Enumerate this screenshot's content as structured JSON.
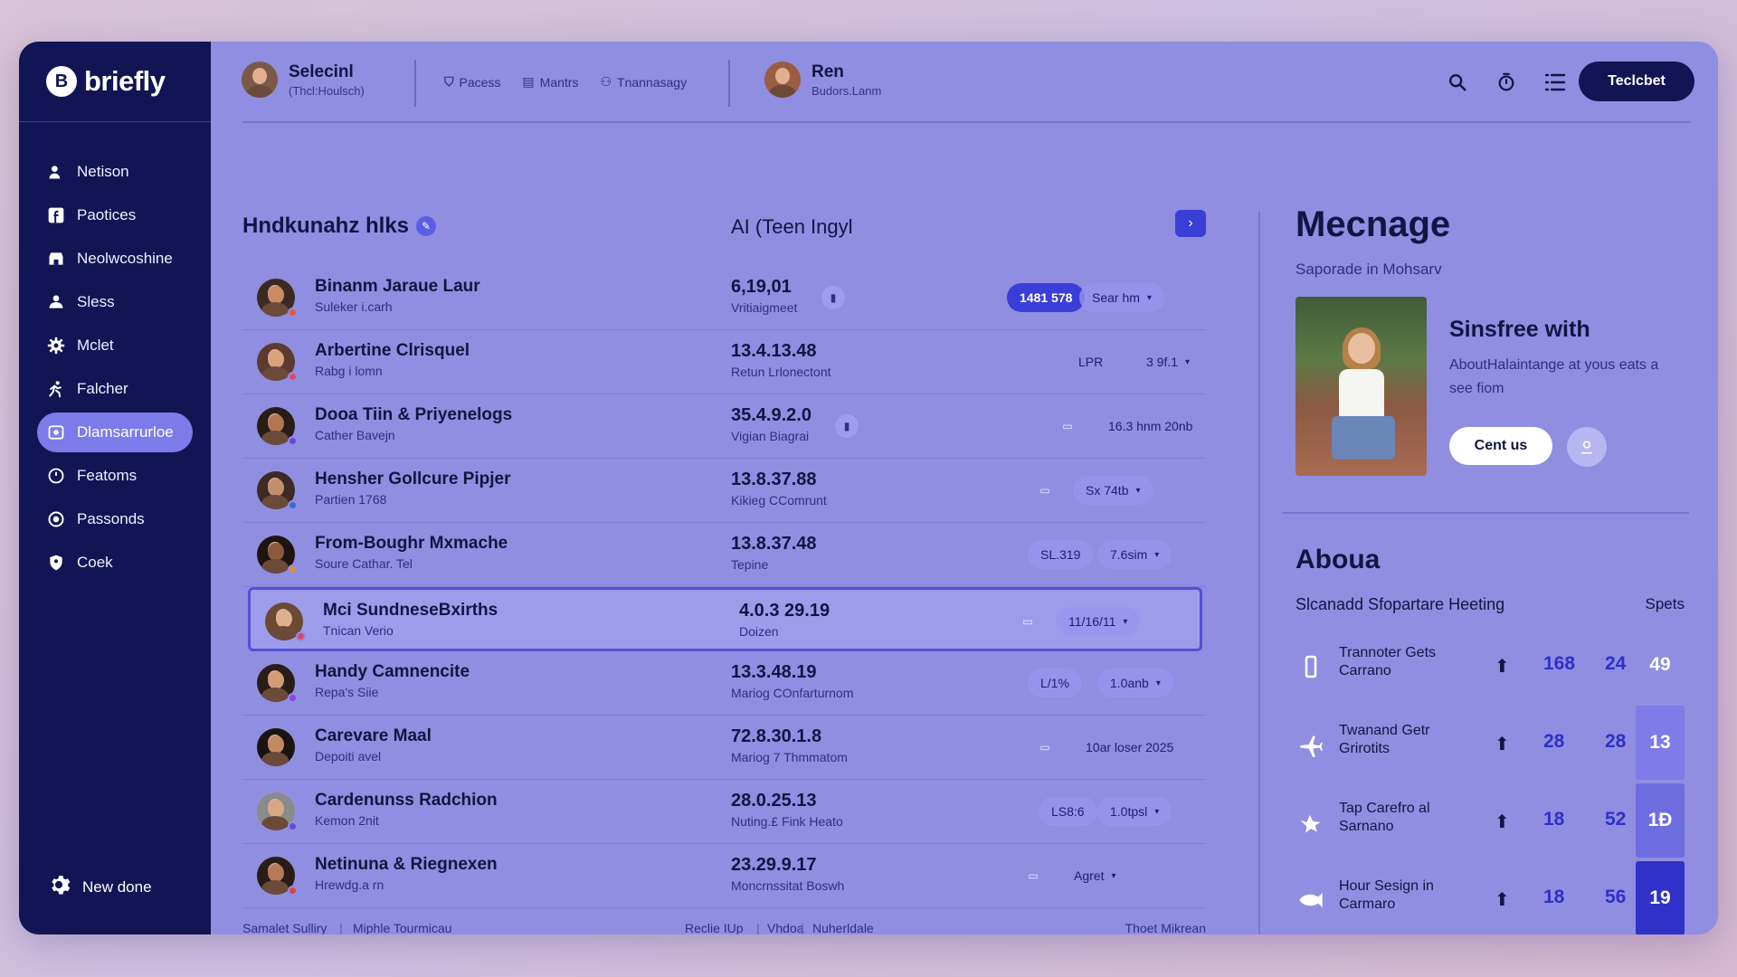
{
  "app": {
    "name": "briefly",
    "logo_letter": "B"
  },
  "sidebar": {
    "items": [
      {
        "label": "Netison",
        "icon": "person-lock-icon"
      },
      {
        "label": "Paotices",
        "icon": "facebook-icon"
      },
      {
        "label": "Neolwcoshine",
        "icon": "store-icon"
      },
      {
        "label": "Sless",
        "icon": "users-icon"
      },
      {
        "label": "Mclet",
        "icon": "gear-icon"
      },
      {
        "label": "Falcher",
        "icon": "person-run-icon"
      },
      {
        "label": "Dlamsarrurloe",
        "icon": "image-icon",
        "active": true
      },
      {
        "label": "Featoms",
        "icon": "clock-icon"
      },
      {
        "label": "Passonds",
        "icon": "target-icon"
      },
      {
        "label": "Coek",
        "icon": "shield-icon"
      }
    ],
    "bottom_label": "New done"
  },
  "header": {
    "user1": {
      "name": "Selecinl",
      "sub": "(Thcl:Houlsch)"
    },
    "nav": [
      "Pacess",
      "Mantrs",
      "Tnannasagy"
    ],
    "user2": {
      "name": "Ren",
      "sub": "Budors.Lanm"
    },
    "primary_button": "Teclcbet",
    "accent": "#111554"
  },
  "list": {
    "title": "Hndkunahz hlks",
    "column_title": "AI (Teen Ingyl",
    "rows": [
      {
        "name": "Binanm Jaraue Laur",
        "sub": "Suleker i.carh",
        "num": "6,19,01",
        "num_sub": "Vritiaigmeet",
        "pill1": "1481 578",
        "pill2": "Sear hm",
        "status": "#e45a3d",
        "skin": "#c98b62",
        "hair": "#3b2a22"
      },
      {
        "name": "Arbertine Clrisquel",
        "sub": "Rabg i lomn",
        "num": "13.4.13.48",
        "num_sub": "Retun Lrlonectont",
        "pill1": "LPR",
        "pill2": "3 9f.1",
        "status": "#e0457b",
        "skin": "#d9a37e",
        "hair": "#5c3a2e"
      },
      {
        "name": "Dooa Tiin & Priyenelogs",
        "sub": "Cather Bavejn",
        "num": "35.4.9.2.0",
        "num_sub": "Vigian Biagrai",
        "pill1": "",
        "pill2": "16.3 hnm 20nb",
        "status": "#6a4ae0",
        "skin": "#b07852",
        "hair": "#2a1c16"
      },
      {
        "name": "Hensher Gollcure Pipjer",
        "sub": "Partien 1768",
        "num": "13.8.37.88",
        "num_sub": "Kikieg CComrunt",
        "pill1": "",
        "pill2": "Sx 74tb",
        "status": "#3b6ae0",
        "skin": "#c48f6c",
        "hair": "#3d2a24"
      },
      {
        "name": "From-Boughr Mxmache",
        "sub": "Soure Cathar. Tel",
        "num": "13.8.37.48",
        "num_sub": "Tepine",
        "pill1": "SL.319",
        "pill2": "7.6sim",
        "status": "#e08a3d",
        "skin": "#8a5a3e",
        "hair": "#1e1410"
      },
      {
        "name": "Mci SundneseBxirths",
        "sub": "Tnican Verio",
        "num": "4.0.3 29.19",
        "num_sub": "Doizen",
        "pill1": "",
        "pill2": "11/16/11",
        "status": "#e04570",
        "skin": "#dcb08e",
        "hair": "#6b4a32",
        "selected": true
      },
      {
        "name": "Handy Camnencite",
        "sub": "Repa's Siie",
        "num": "13.3.48.19",
        "num_sub": "Mariog COnfarturnom",
        "pill1": "L/1%",
        "pill2": "1.0anb",
        "status": "#8a4ae0",
        "skin": "#d19c76",
        "hair": "#2a1c16"
      },
      {
        "name": "Carevare Maal",
        "sub": "Depoiti avel",
        "num": "72.8.30.1.8",
        "num_sub": "Mariog 7 Thmmatom",
        "pill1": "",
        "pill2": "10ar loser 2025",
        "status": "",
        "skin": "#c08a64",
        "hair": "#1a1410"
      },
      {
        "name": "Cardenunss Radchion",
        "sub": "Kemon 2nit",
        "num": "28.0.25.13",
        "num_sub": "Nuting.£ Fink Heato",
        "pill1": "LS8:6",
        "pill2": "1.0tpsl",
        "status": "#6a4ae0",
        "skin": "#d6a986",
        "hair": "#8a8a8a"
      },
      {
        "name": "Netinuna & Riegnexen",
        "sub": "Hrewdg.a rn",
        "num": "23.29.9.17",
        "num_sub": "Moncrnssitat Boswh",
        "pill1": "",
        "pill2": "Agret",
        "status": "#e04545",
        "skin": "#b57a58",
        "hair": "#2a1c16"
      }
    ],
    "footer": {
      "left": [
        "Samalet Sulliry",
        "Miphle Tourmicau"
      ],
      "mid": [
        "Reclie IUp",
        "Vhdoa",
        "Nuherldale"
      ],
      "right": "Thoet Mikrean"
    }
  },
  "right": {
    "title": "Mecnage",
    "sub": "Saporade in Mohsarv",
    "card_title": "Sinsfree with",
    "card_text": "AboutHalaintange at yous eats a see fiom",
    "cta": "Cent us",
    "about": "Aboua",
    "meet_head": "Slcanadd Sfopartare Heeting",
    "meet_col": "Spets",
    "stats": [
      {
        "name": "Trannoter Gets Carrano",
        "icon": "bracket-icon",
        "a": "168",
        "b": "24",
        "c": "49",
        "c_bg": "rgba(150,150,240,0)"
      },
      {
        "name": "Twanand Getr Grirotits",
        "icon": "plane-icon",
        "a": "28",
        "b": "28",
        "c": "13",
        "c_bg": "#7d7ce8"
      },
      {
        "name": "Tap Carefro al Sarnano",
        "icon": "bird-icon",
        "a": "18",
        "b": "52",
        "c": "1Đ",
        "c_bg": "#6e6de0"
      },
      {
        "name": "Hour Sesign in Carmaro",
        "icon": "fish-icon",
        "a": "18",
        "b": "56",
        "c": "19",
        "c_bg": "#2f31c8"
      }
    ]
  }
}
